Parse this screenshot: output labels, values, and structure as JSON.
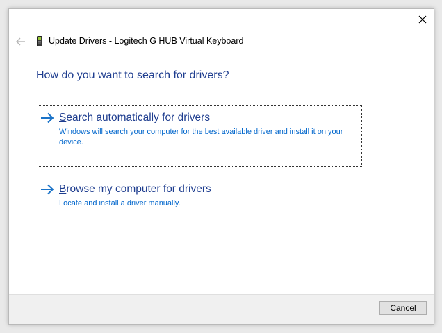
{
  "window": {
    "title": "Update Drivers - Logitech G HUB Virtual Keyboard"
  },
  "icons": {
    "close": "close-icon",
    "back": "back-arrow-icon",
    "device": "keyboard-device-icon",
    "option_arrow": "right-arrow-icon"
  },
  "heading": "How do you want to search for drivers?",
  "options": [
    {
      "title_first": "S",
      "title_rest": "earch automatically for drivers",
      "description": "Windows will search your computer for the best available driver and install it on your device."
    },
    {
      "title_first": "B",
      "title_rest": "rowse my computer for drivers",
      "description": "Locate and install a driver manually."
    }
  ],
  "footer": {
    "cancel_label": "Cancel"
  },
  "colors": {
    "heading": "#1e3d8f",
    "link": "#0066cc",
    "arrow": "#1a73c8",
    "footer_bg": "#f0f0f0"
  }
}
